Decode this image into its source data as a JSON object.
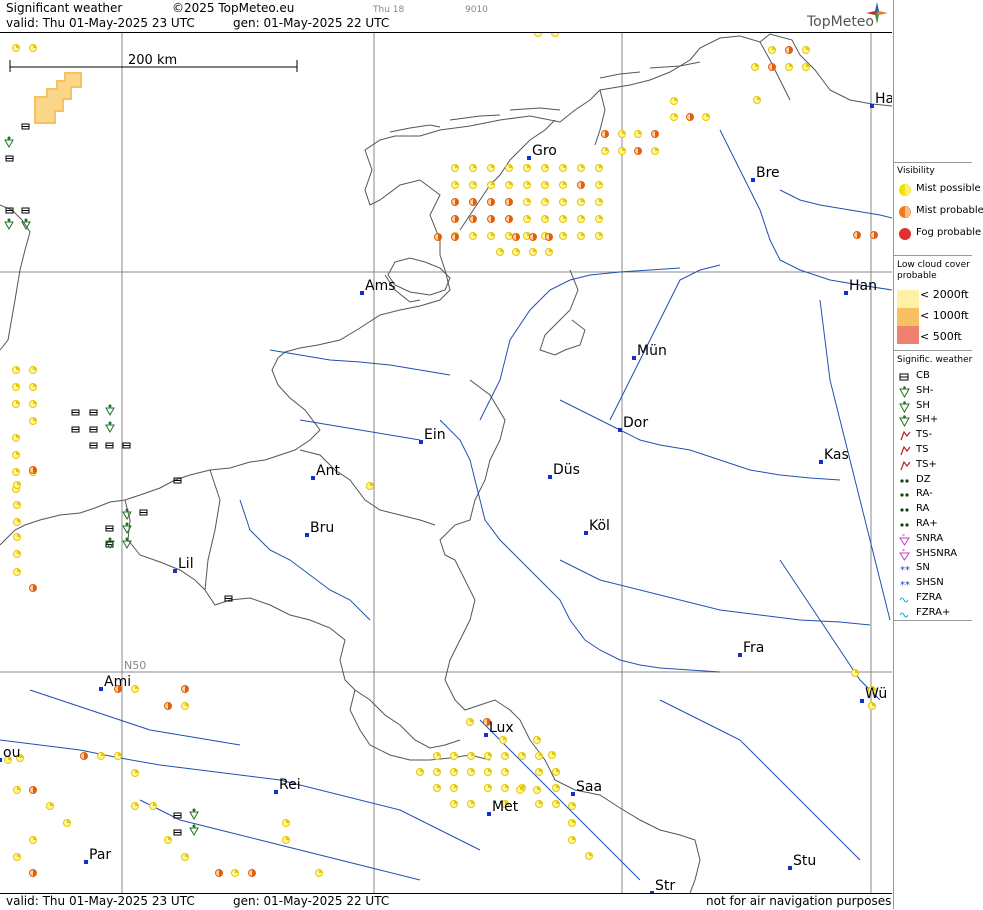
{
  "header": {
    "title": "Significant weather",
    "copyright": "©2025 TopMeteo.eu",
    "day_label": "Thu 18",
    "code": "9010",
    "valid": "valid:  Thu   01-May-2025   23 UTC",
    "gen": "gen: 01-May-2025 22 UTC",
    "logo": "TopMeteo"
  },
  "footer": {
    "valid": "valid:  Thu   01-May-2025   23 UTC",
    "gen": "gen: 01-May-2025 22 UTC",
    "disclaimer": "not for air navigation purposes"
  },
  "map": {
    "scale_label": "200 km",
    "lat_label": "N50",
    "cities": [
      {
        "name": "Gro"
      },
      {
        "name": "Bre"
      },
      {
        "name": "Ha"
      },
      {
        "name": "Ams"
      },
      {
        "name": "Han"
      },
      {
        "name": "Mün"
      },
      {
        "name": "Dor"
      },
      {
        "name": "Ein"
      },
      {
        "name": "Kas"
      },
      {
        "name": "Ant"
      },
      {
        "name": "Düs"
      },
      {
        "name": "Köl"
      },
      {
        "name": "Bru"
      },
      {
        "name": "Lil"
      },
      {
        "name": "Fra"
      },
      {
        "name": "Ami"
      },
      {
        "name": "Wü"
      },
      {
        "name": "Lux"
      },
      {
        "name": "ou"
      },
      {
        "name": "Rei"
      },
      {
        "name": "Saa"
      },
      {
        "name": "Met"
      },
      {
        "name": "Par"
      },
      {
        "name": "Stu"
      },
      {
        "name": "Str"
      }
    ]
  },
  "legend": {
    "visibility_title": "Visibility",
    "visibility": [
      {
        "label": "Mist possible",
        "color": "#f3e000"
      },
      {
        "label": "Mist probable",
        "color": "#f07a1a"
      },
      {
        "label": "Fog probable",
        "color": "#e03030"
      }
    ],
    "lowcloud_title": "Low cloud cover probable",
    "lowcloud": [
      {
        "label": "< 2000ft",
        "color": "#fff0a8"
      },
      {
        "label": "< 1000ft",
        "color": "#f8c060"
      },
      {
        "label": "<   500ft",
        "color": "#f08070"
      }
    ],
    "sigwx_title": "Signific. weather",
    "sigwx": [
      {
        "label": "CB",
        "icon": "cb-icon"
      },
      {
        "label": "SH-",
        "icon": "shower-light-icon"
      },
      {
        "label": "SH",
        "icon": "shower-icon"
      },
      {
        "label": "SH+",
        "icon": "shower-heavy-icon"
      },
      {
        "label": "TS-",
        "icon": "thunderstorm-light-icon"
      },
      {
        "label": "TS",
        "icon": "thunderstorm-icon"
      },
      {
        "label": "TS+",
        "icon": "thunderstorm-heavy-icon"
      },
      {
        "label": "DZ",
        "icon": "drizzle-icon"
      },
      {
        "label": "RA-",
        "icon": "rain-light-icon"
      },
      {
        "label": "RA",
        "icon": "rain-icon"
      },
      {
        "label": "RA+",
        "icon": "rain-heavy-icon"
      },
      {
        "label": "SNRA",
        "icon": "snow-rain-icon"
      },
      {
        "label": "SHSNRA",
        "icon": "snow-rain-shower-icon"
      },
      {
        "label": "SN",
        "icon": "snow-icon"
      },
      {
        "label": "SHSN",
        "icon": "snow-shower-icon"
      },
      {
        "label": "FZRA",
        "icon": "freezing-rain-icon"
      },
      {
        "label": "FZRA+",
        "icon": "freezing-rain-heavy-icon"
      }
    ]
  }
}
